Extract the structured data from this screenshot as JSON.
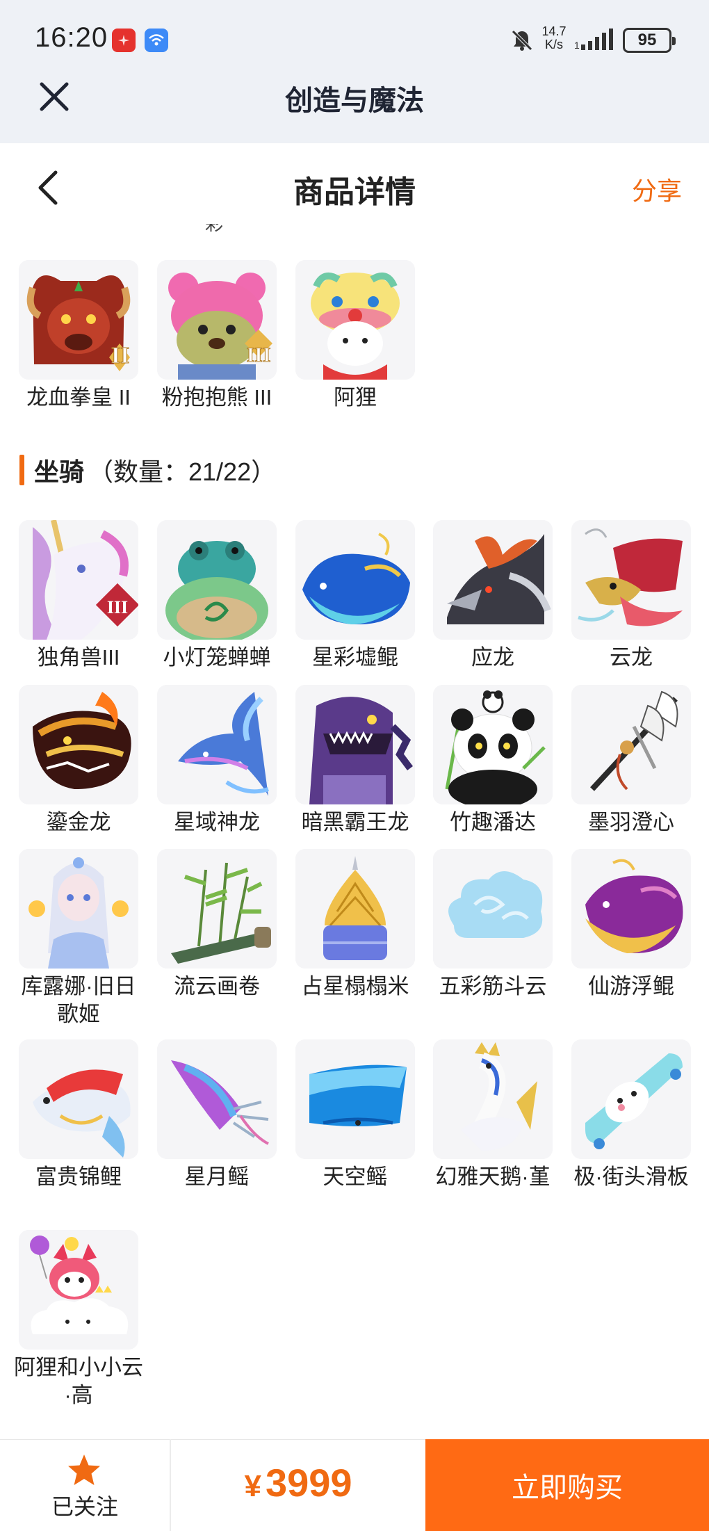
{
  "status_bar": {
    "time": "16:20",
    "net_speed_value": "14.7",
    "net_speed_unit": "K/s",
    "battery": "95"
  },
  "webview": {
    "title": "创造与魔法"
  },
  "nav": {
    "title": "商品详情",
    "share": "分享"
  },
  "cut_text": "彩",
  "top_items": [
    {
      "name": "龙血拳皇 II",
      "icon": "red-dragon-fighter",
      "tier": "II"
    },
    {
      "name": "粉抱抱熊 III",
      "icon": "pink-bear",
      "tier": "III"
    },
    {
      "name": "阿狸",
      "icon": "ali-lion-dance"
    }
  ],
  "mounts": {
    "label": "坐骑",
    "count_text": "（数量：21/22）",
    "items": [
      {
        "name": "独角兽III",
        "icon": "unicorn",
        "tier": "III"
      },
      {
        "name": "小灯笼蝉蝉",
        "icon": "lantern-frog"
      },
      {
        "name": "星彩墟鲲",
        "icon": "blue-whale"
      },
      {
        "name": "应龙",
        "icon": "dark-dragon"
      },
      {
        "name": "云龙",
        "icon": "cloud-dragon"
      },
      {
        "name": "鎏金龙",
        "icon": "golden-dragon"
      },
      {
        "name": "星域神龙",
        "icon": "star-dragon"
      },
      {
        "name": "暗黑霸王龙",
        "icon": "dark-trex"
      },
      {
        "name": "竹趣潘达",
        "icon": "panda"
      },
      {
        "name": "墨羽澄心",
        "icon": "feather-sword"
      },
      {
        "name": "库露娜·旧日歌姬",
        "icon": "kuluna-singer"
      },
      {
        "name": "流云画卷",
        "icon": "bamboo-scroll"
      },
      {
        "name": "占星榻榻米",
        "icon": "astro-tatami"
      },
      {
        "name": "五彩筋斗云",
        "icon": "cloud"
      },
      {
        "name": "仙游浮鲲",
        "icon": "floating-whale"
      },
      {
        "name": "富贵锦鲤",
        "icon": "koi"
      },
      {
        "name": "星月鳐",
        "icon": "star-ray"
      },
      {
        "name": "天空鳐",
        "icon": "sky-ray"
      },
      {
        "name": "幻雅天鹅·堇",
        "icon": "swan"
      },
      {
        "name": "极·街头滑板",
        "icon": "skateboard"
      },
      {
        "name": "阿狸和小小云·高",
        "icon": "ali-cloud"
      }
    ]
  },
  "bottom": {
    "follow_label": "已关注",
    "currency": "¥",
    "price": "3999",
    "buy_label": "立即购买"
  },
  "colors": {
    "accent": "#f06a12",
    "buy_button": "#ff6a14",
    "header_bg": "#eef1f6"
  }
}
